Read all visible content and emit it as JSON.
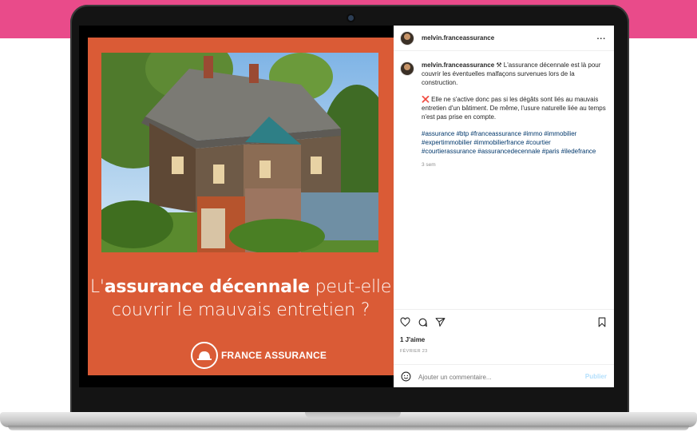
{
  "post": {
    "headline_pre": "L'",
    "headline_bold": "assurance décennale",
    "headline_mid": " peut-elle",
    "headline_line2": "couvrir le mauvais entretien ?",
    "brand": "FRANCE ASSURANCE"
  },
  "header": {
    "username": "melvin.franceassurance",
    "more": "..."
  },
  "caption": {
    "username": "melvin.franceassurance",
    "para1": " ⚒ L'assurance décennale est là pour couvrir les éventuelles malfaçons survenues lors de la construction.",
    "para2": "❌ Elle ne s'active donc pas si les dégâts sont liés au mauvais entretien d'un bâtiment. De même, l'usure naturelle liée au temps n'est pas prise en compte.",
    "hashtags": "#assurance #btp #franceassurance #immo #immobilier #expertimmobilier #immobilierfrance #courtier #courtierassurance #assurancedecennale #paris #iledefrance",
    "time": "3 sem"
  },
  "actions": {
    "likes": "1 J'aime",
    "date": "FÉVRIER 23",
    "comment_placeholder": "Ajouter un commentaire...",
    "publish": "Publier"
  },
  "icons": [
    "heart-icon",
    "comment-icon",
    "share-icon",
    "bookmark-icon",
    "emoji-icon",
    "helmet-icon"
  ],
  "colors": {
    "band": "#e94b8a",
    "post_bg": "#da5b36",
    "hashtag": "#00376b",
    "publish": "#b2dffc"
  }
}
